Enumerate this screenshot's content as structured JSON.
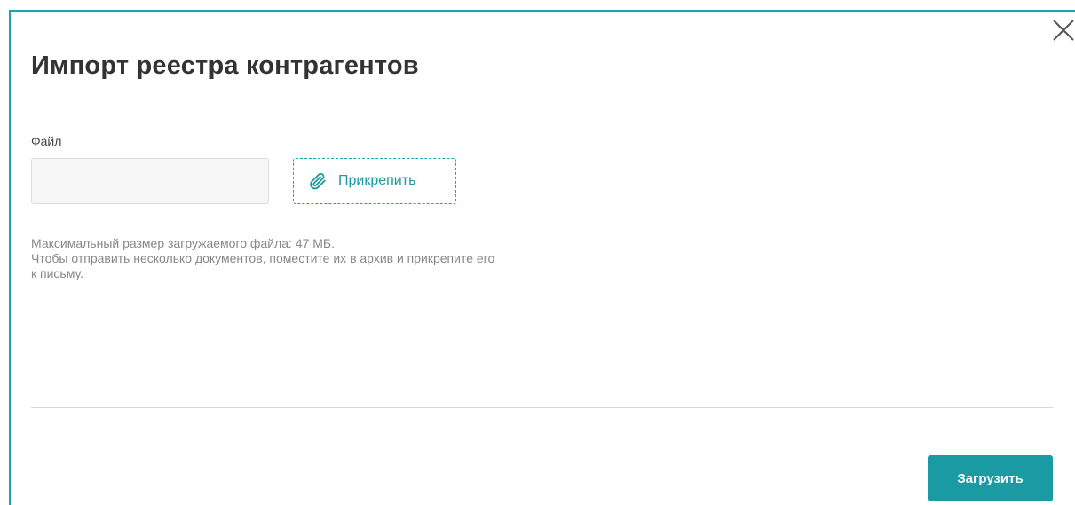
{
  "dialog": {
    "title": "Импорт реестра контрагентов",
    "close_icon": "close-icon"
  },
  "file_field": {
    "label": "Файл",
    "value": "",
    "placeholder": ""
  },
  "attach_button": {
    "label": "Прикрепить",
    "icon": "paperclip-icon"
  },
  "hint": {
    "lines": [
      "Максимальный размер загружаемого файла: 47 МБ.",
      "Чтобы отправить несколько документов, поместите их в архив и прикрепите его",
      "к письму."
    ]
  },
  "footer": {
    "upload_label": "Загрузить"
  },
  "colors": {
    "accent": "#1a9aa2",
    "border_accent": "#1aa5ad",
    "title_text": "#333333",
    "hint_text": "#888888"
  }
}
